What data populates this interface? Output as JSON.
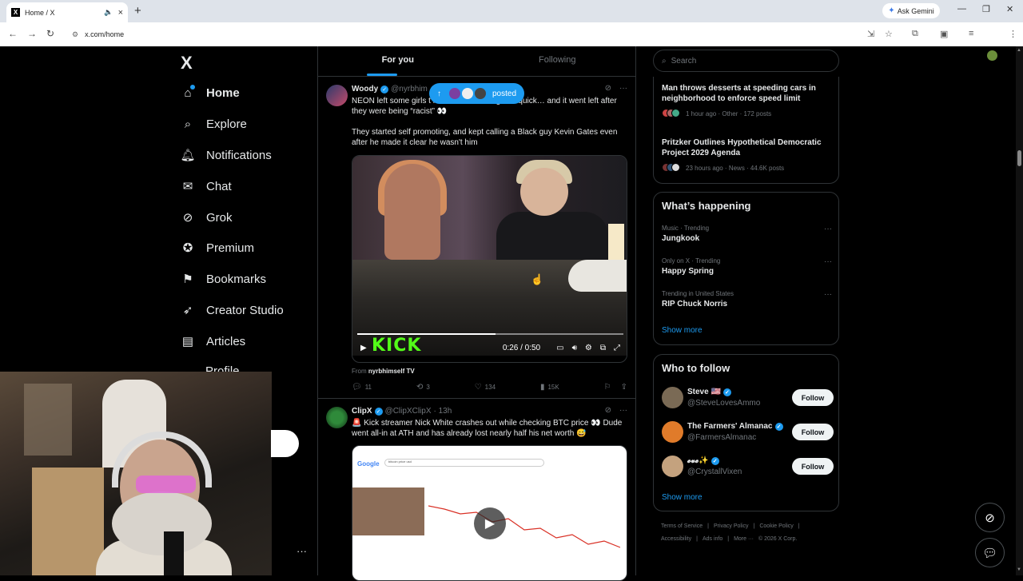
{
  "browser": {
    "tab_title": "Home / X",
    "tab_favicon": "X",
    "new_tab": "+",
    "ask_gemini": "Ask Gemini",
    "url": "x.com/home",
    "win_min": "—",
    "win_max": "❐",
    "win_close": "✕"
  },
  "nav": {
    "logo": "X",
    "items": [
      {
        "label": "Home",
        "icon": "home-icon"
      },
      {
        "label": "Explore",
        "icon": "search-icon"
      },
      {
        "label": "Notifications",
        "icon": "bell-icon"
      },
      {
        "label": "Chat",
        "icon": "mail-icon"
      },
      {
        "label": "Grok",
        "icon": "grok-icon"
      },
      {
        "label": "Premium",
        "icon": "verified-icon"
      },
      {
        "label": "Bookmarks",
        "icon": "bookmark-icon"
      },
      {
        "label": "Creator Studio",
        "icon": "rocket-icon"
      },
      {
        "label": "Articles",
        "icon": "article-icon"
      },
      {
        "label": "Profile",
        "icon": "person-icon"
      }
    ],
    "more": "···"
  },
  "timeline": {
    "tabs": [
      "For you",
      "Following"
    ],
    "posted_pill": "posted",
    "post1": {
      "name": "Woody",
      "handle": "@nyrbhim",
      "text1": "NEON left some girls t handled something real quick… and it went left after they were being “racist” 👀",
      "text2": "They started self promoting, and kept calling a Black guy Kevin Gates even after he made it clear he wasn't him",
      "video_brand": "KICK",
      "video_time": "0:26 / 0:50",
      "video_progress": 0.52,
      "from_label": "From",
      "from_source": "nyrbhimself TV",
      "replies": "11",
      "reposts": "3",
      "likes": "134",
      "views": "15K"
    },
    "post2": {
      "name": "ClipX",
      "handle": "@ClipXClipX",
      "time": "· 13h",
      "text": "🚨 Kick streamer Nick White crashes out while checking BTC price 👀 Dude went all-in at ATH and has already lost nearly half his net worth 😅",
      "search_text": "bitcoin price usd",
      "google": "Google"
    }
  },
  "right": {
    "search_placeholder": "Search",
    "news": [
      {
        "headline": "Man throws desserts at speeding cars in neighborhood to enforce speed limit",
        "meta": "1 hour ago · Other · 172 posts"
      },
      {
        "headline": "Pritzker Outlines Hypothetical Democratic Project 2029 Agenda",
        "meta": "23 hours ago · News · 44.6K posts"
      }
    ],
    "happening_title": "What’s happening",
    "trends": [
      {
        "context": "Music · Trending",
        "name": "Jungkook"
      },
      {
        "context": "Only on X · Trending",
        "name": "Happy Spring"
      },
      {
        "context": "Trending in United States",
        "name": "RIP Chuck Norris"
      }
    ],
    "show_more": "Show more",
    "wtf_title": "Who to follow",
    "follow": [
      {
        "name": "Steve 🇺🇸",
        "handle": "@SteveLovesAmmo",
        "button": "Follow",
        "color": "#7a6a55"
      },
      {
        "name": "The Farmers' Almanac",
        "handle": "@FarmersAlmanac",
        "button": "Follow",
        "color": "#e07b2a"
      },
      {
        "name": "𝓮𝓿𝓮✨",
        "handle": "@CrystallVixen",
        "button": "Follow",
        "color": "#c4a27e"
      }
    ],
    "show_more_2": "Show more",
    "footer_row1": [
      "Terms of Service",
      "|",
      "Privacy Policy",
      "|",
      "Cookie Policy",
      "|"
    ],
    "footer_row2": [
      "Accessibility",
      "|",
      "Ads info",
      "|",
      "More ···",
      "© 2026 X Corp."
    ]
  },
  "colors": {
    "accent": "#1d9bf0",
    "bg": "#000000",
    "border": "#2f3336",
    "muted": "#71767b"
  }
}
